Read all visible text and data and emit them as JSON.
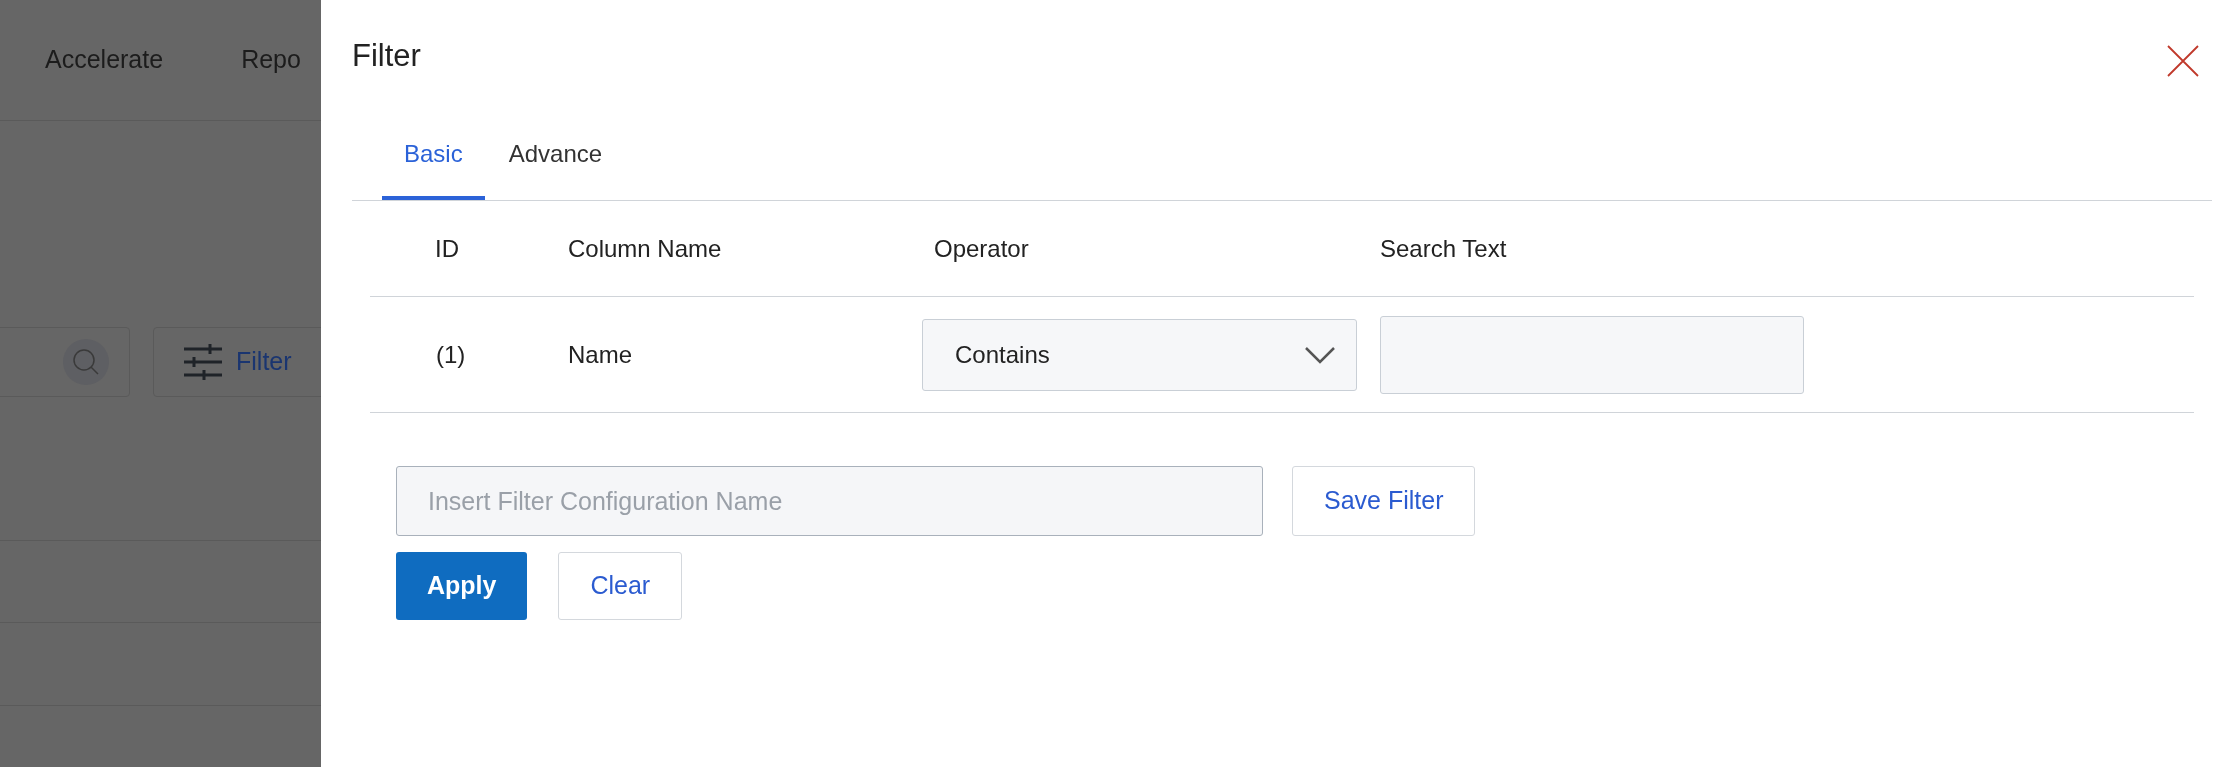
{
  "background": {
    "nav_items": [
      "Accelerate",
      "Repo"
    ],
    "filter_button": {
      "label": "Filter"
    }
  },
  "dialog": {
    "title": "Filter",
    "tabs": [
      {
        "label": "Basic",
        "selected": true
      },
      {
        "label": "Advance",
        "selected": false
      }
    ],
    "table": {
      "columns": [
        "ID",
        "Column Name",
        "Operator",
        "Search Text"
      ],
      "rows": [
        {
          "id": "(1)",
          "column_name": "Name",
          "operator": "Contains"
        }
      ]
    },
    "config_field": {
      "placeholder": "Insert Filter Configuration Name"
    },
    "save_button": "Save Filter",
    "apply_button": "Apply",
    "clear_button": "Clear"
  }
}
